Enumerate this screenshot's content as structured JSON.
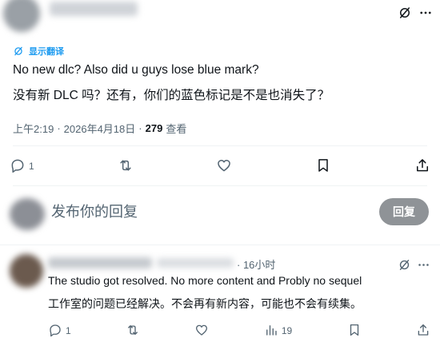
{
  "tweet": {
    "translate_label": "显示翻译",
    "text_en": "No new dlc? Also did u guys lose blue mark?",
    "text_zh": "没有新 DLC 吗？还有，你们的蓝色标记是不是也消失了？",
    "time": "上午2:19",
    "separator": "·",
    "date": "2026年4月18日",
    "views_count": "279",
    "views_label": "查看",
    "actions": {
      "reply_count": "1",
      "retweet_count": "",
      "like_count": ""
    }
  },
  "reply_box": {
    "placeholder": "发布你的回复",
    "button_label": "回复"
  },
  "comment": {
    "time": "· 16小时",
    "text_en": "The studio got resolved. No more content and Probly no sequel",
    "text_zh": "工作室的问题已经解决。不会再有新内容，可能也不会有续集。",
    "actions": {
      "reply_count": "1",
      "retweet_count": "",
      "like_count": "",
      "views_count": "19"
    }
  },
  "colors": {
    "accent": "#1d9bf0",
    "text_primary": "#0f1419",
    "text_secondary": "#536471",
    "divider": "#eff3f4",
    "button_disabled": "#8f9397"
  },
  "icons": [
    "translate-icon",
    "reply-icon",
    "retweet-icon",
    "like-icon",
    "bookmark-icon",
    "share-icon",
    "analytics-icon",
    "grok-icon"
  ]
}
